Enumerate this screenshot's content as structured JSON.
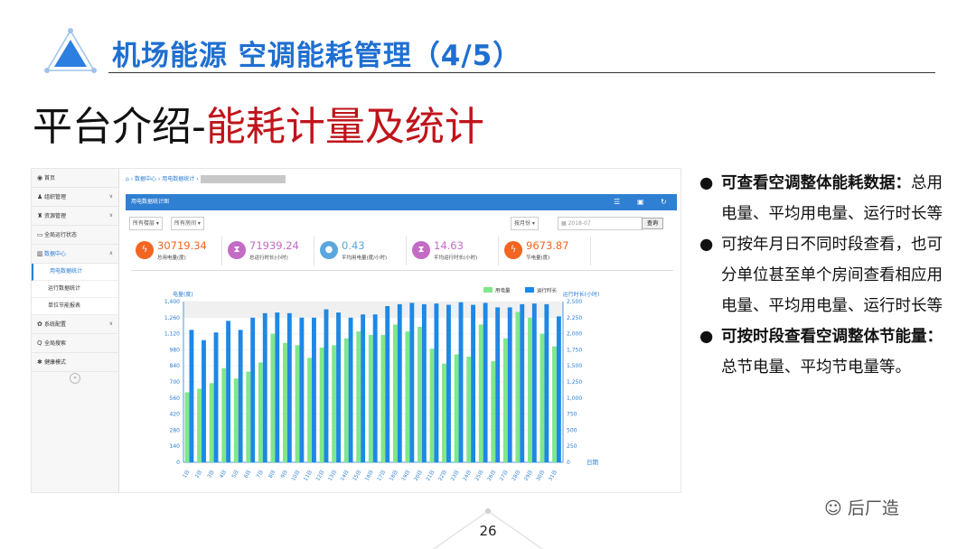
{
  "slide": {
    "title": "机场能源 空调能耗管理（4/5）",
    "subtitle_black": "平台介绍-",
    "subtitle_red": "能耗计量及统计",
    "page_number": "26",
    "watermark": "后厂造"
  },
  "app": {
    "sidebar": [
      {
        "icon": "home-icon",
        "label": "首页"
      },
      {
        "icon": "users-icon",
        "label": "组织管理"
      },
      {
        "icon": "building-icon",
        "label": "资源管理"
      },
      {
        "icon": "monitor-icon",
        "label": "全局运行状态"
      },
      {
        "icon": "bar-chart-icon",
        "label": "数据中心"
      },
      {
        "label": "用电数据统计"
      },
      {
        "label": "运行数据统计"
      },
      {
        "label": "单位节能报表"
      },
      {
        "icon": "gear-icon",
        "label": "系统配置"
      },
      {
        "icon": "search-icon",
        "label": "全局搜索"
      },
      {
        "icon": "star-icon",
        "label": "健康模式"
      }
    ],
    "breadcrumb": [
      "数据中心",
      "用电数据统计"
    ],
    "panel_title": "用电数据统计图",
    "filters": {
      "group": "所有楼层",
      "device": "所有房间",
      "period": "按月份",
      "date": "2018-07",
      "query": "查询"
    },
    "stats": [
      {
        "value": "30719.34",
        "label": "总用电量(度)",
        "color": "#f26522",
        "icon": "lightning-icon"
      },
      {
        "value": "71939.24",
        "label": "总运行时长(小时)",
        "color": "#c36bc5",
        "icon": "hourglass-icon"
      },
      {
        "value": "0.43",
        "label": "平均用电量(度/小时)",
        "color": "#5aa7dd",
        "icon": "drop-icon"
      },
      {
        "value": "14.63",
        "label": "平均运行时长(小时)",
        "color": "#c36bc5",
        "icon": "hourglass-icon"
      },
      {
        "value": "9673.87",
        "label": "节电量(度)",
        "color": "#f26522",
        "icon": "lightning-icon"
      }
    ]
  },
  "bullets": [
    {
      "bold": true,
      "text": "可查看空调整体能耗数据：",
      "rest": "总用电量、平均用电量、运行时长等"
    },
    {
      "bold": false,
      "text": "可按年月日不同时段查看，也可分单位甚至单个房间查看相应用电量、平均用电量、运行时长等",
      "rest": ""
    },
    {
      "bold": true,
      "text": "可按时段查看空调整体节能量：",
      "rest": "总节电量、平均节电量等。"
    }
  ],
  "chart_data": {
    "type": "bar",
    "ylabel": "电量(度)",
    "y2label": "运行时长(小时)",
    "xlabel": "日期",
    "ylim": [
      0,
      1400
    ],
    "y2lim": [
      0,
      2500
    ],
    "yticks": [
      "0",
      "140",
      "280",
      "420",
      "560",
      "700",
      "840",
      "980",
      "1,120",
      "1,260",
      "1,400"
    ],
    "y2ticks": [
      "0",
      "250",
      "500",
      "750",
      "1,000",
      "1,250",
      "1,500",
      "1,750",
      "2,000",
      "2,250",
      "2,500"
    ],
    "categories": [
      "1日",
      "2日",
      "3日",
      "4日",
      "5日",
      "6日",
      "7日",
      "8日",
      "9日",
      "10日",
      "11日",
      "12日",
      "13日",
      "14日",
      "15日",
      "16日",
      "17日",
      "18日",
      "19日",
      "20日",
      "21日",
      "22日",
      "23日",
      "24日",
      "25日",
      "26日",
      "27日",
      "28日",
      "29日",
      "30日",
      "31日"
    ],
    "legend_position": "top-right",
    "series": [
      {
        "name": "用电量",
        "axis": "left",
        "color": "#7ee88a",
        "values": [
          610,
          640,
          690,
          820,
          730,
          790,
          870,
          1120,
          1040,
          1020,
          910,
          1000,
          1020,
          1080,
          1140,
          1110,
          1110,
          1200,
          1140,
          1180,
          990,
          860,
          940,
          920,
          1200,
          880,
          1080,
          1310,
          1260,
          1120,
          1010
        ]
      },
      {
        "name": "运行时长",
        "axis": "right",
        "color": "#1e88e5",
        "values": [
          2060,
          1900,
          2020,
          2200,
          2060,
          2250,
          2320,
          2330,
          2320,
          2250,
          2250,
          2380,
          2330,
          2250,
          2300,
          2300,
          2430,
          2460,
          2480,
          2460,
          2470,
          2450,
          2490,
          2450,
          2480,
          2410,
          2410,
          2460,
          2470,
          2460,
          2270
        ]
      }
    ]
  }
}
